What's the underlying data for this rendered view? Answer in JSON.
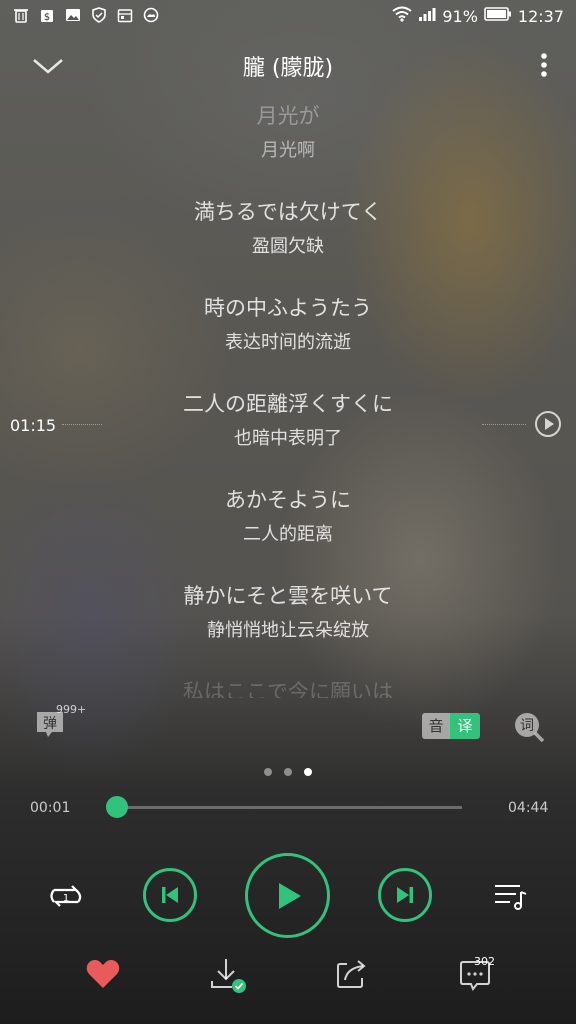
{
  "status_bar": {
    "battery": "91%",
    "time": "12:37",
    "icons_left": [
      "trash-icon",
      "bag-icon",
      "image-icon",
      "shield-icon",
      "calendar-icon",
      "weather-icon"
    ],
    "icons_right": [
      "wifi-icon",
      "signal-icon",
      "battery-icon"
    ]
  },
  "header": {
    "title": "朧 (朦胧)"
  },
  "lyrics": [
    {
      "original": "月光が",
      "translation": "月光啊"
    },
    {
      "original": "満ちるでは欠けてく",
      "translation": "盈圆欠缺"
    },
    {
      "original": "時の中ふようたう",
      "translation": "表达时间的流逝"
    },
    {
      "original": "二人の距離浮くすくに",
      "translation": "也暗中表明了"
    },
    {
      "original": "あかそように",
      "translation": "二人的距离"
    },
    {
      "original": "静かにそと雲を咲いて",
      "translation": "静悄悄地让云朵绽放"
    }
  ],
  "lyric_fade": "私はここで今に願いは",
  "seek": {
    "time": "01:15"
  },
  "danmu": {
    "label": "弹",
    "count": "999+"
  },
  "toggles": {
    "yin": "音",
    "yi": "译"
  },
  "lyrics_search_label": "词",
  "page_indicator": {
    "count": 3,
    "active": 2
  },
  "progress": {
    "current": "00:01",
    "total": "04:44",
    "fraction": 0.004
  },
  "comments": {
    "count": "302"
  },
  "colors": {
    "accent": "#31c27c",
    "heart": "#e95b5b"
  }
}
